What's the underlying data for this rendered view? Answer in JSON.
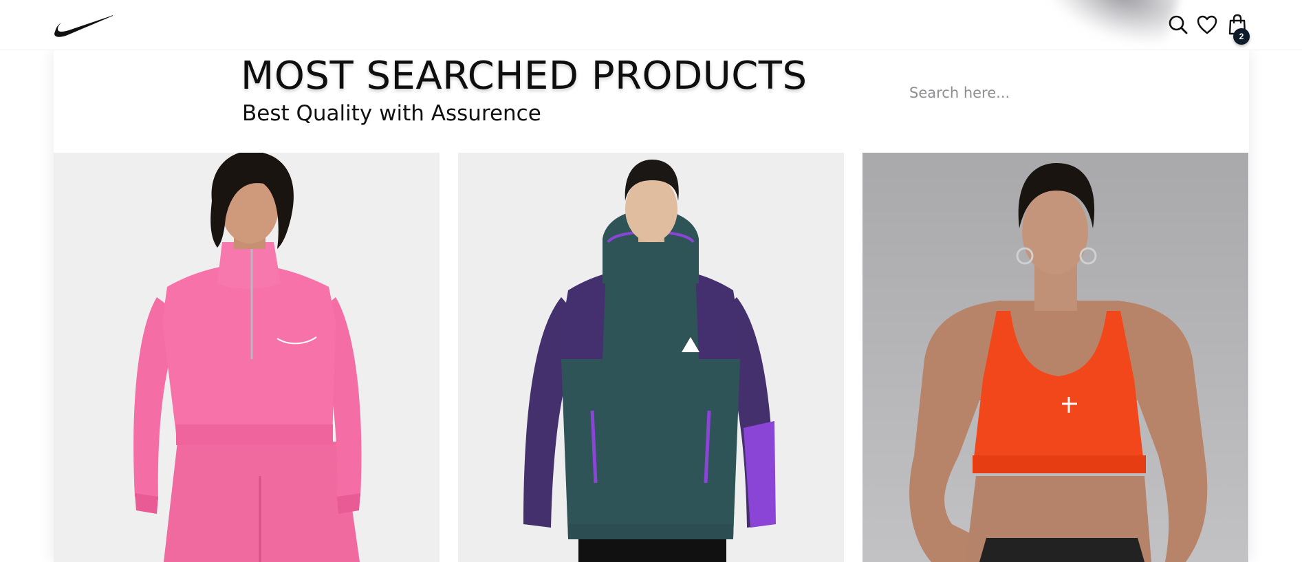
{
  "header": {
    "logo": "nike-swoosh",
    "icons": [
      "search-icon",
      "heart-icon",
      "bag-icon"
    ],
    "cart_count": "2"
  },
  "section": {
    "title": "MOST SEARCHED PRODUCTS",
    "subtitle": "Best Quality with Assurence"
  },
  "search": {
    "placeholder": "Search here..."
  },
  "products": [
    {
      "image": "woman in pink half-zip cropped sweatshirt",
      "accent": "#f26aa0"
    },
    {
      "image": "man in purple and teal fleece hoodie",
      "accent": "#45306e"
    },
    {
      "image": "woman in orange sports bra",
      "accent": "#f2471a"
    }
  ],
  "colors": {
    "text": "#0e0e0e",
    "badge": "#0d1b2a",
    "placeholder": "#8e8e93"
  }
}
